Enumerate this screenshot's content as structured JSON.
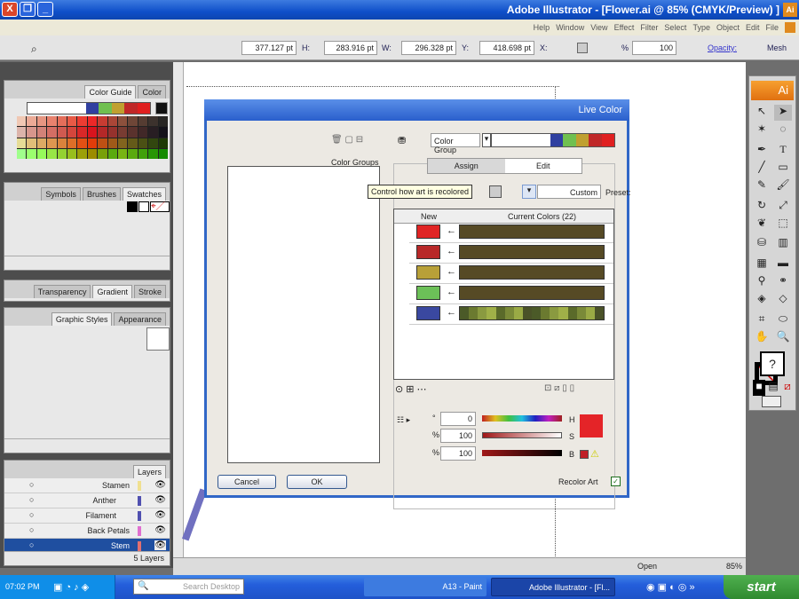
{
  "window": {
    "title": "Adobe Illustrator - [Flower.ai @ 85% (CMYK/Preview) ]",
    "close": "X",
    "restore": "❐",
    "minimize": "_"
  },
  "menu": [
    "File",
    "Edit",
    "Object",
    "Type",
    "Select",
    "Filter",
    "Effect",
    "View",
    "Window",
    "Help"
  ],
  "control": {
    "mode": "Mesh",
    "opacity_label": "Opacity:",
    "opacity": "100",
    "percent": "%",
    "x_label": "X:",
    "x": "418.698 pt",
    "y_label": "Y:",
    "y": "296.328 pt",
    "w_label": "W:",
    "w": "283.916 pt",
    "h_label": "H:",
    "h": "377.127 pt"
  },
  "panels": {
    "color": {
      "tabs": [
        "Color",
        "Color Guide"
      ]
    },
    "swatches": {
      "tabs": [
        "Swatches",
        "Brushes",
        "Symbols"
      ]
    },
    "stroke": {
      "tabs": [
        "Stroke",
        "Gradient",
        "Transparency"
      ]
    },
    "appearance": {
      "tabs": [
        "Appearance",
        "Graphic Styles"
      ]
    },
    "layers": {
      "tab": "Layers",
      "items": [
        "Stamen",
        "Anther",
        "Filament",
        "Back Petals",
        "Stem"
      ],
      "count": "5 Layers",
      "colors": [
        "#f0e090",
        "#5050b0",
        "#5050b0",
        "#e070d0",
        "#e07070"
      ]
    }
  },
  "guide_colors": [
    "#e02020",
    "#c02828",
    "#c0a030",
    "#70c050",
    "#3040a0"
  ],
  "dialog": {
    "title": "Live Color",
    "group_name": "Color Group",
    "color_groups_label": "Color Groups",
    "tabs": [
      "Edit",
      "Assign"
    ],
    "preset_label": "Preset:",
    "preset": "Custom",
    "tooltip": "Control how art is recolored",
    "col_current": "Current Colors (22)",
    "col_new": "New",
    "rows": [
      {
        "new": "#e02424"
      },
      {
        "new": "#b82828"
      },
      {
        "new": "#b8a038"
      },
      {
        "new": "#6cc058"
      },
      {
        "new": "#3a48a0"
      }
    ],
    "h_label": "H",
    "h": "0",
    "h_unit": "°",
    "s_label": "S",
    "s": "100",
    "s_unit": "%",
    "b_label": "B",
    "b": "100",
    "b_unit": "%",
    "swatch": "#e42428",
    "recolor_label": "Recolor Art",
    "ok": "OK",
    "cancel": "Cancel"
  },
  "status": {
    "zoom": "85%",
    "state": "Open"
  },
  "taskbar": {
    "start": "start",
    "tasks": [
      "Adobe Illustrator - [Fl...",
      "A13 - Paint"
    ],
    "search": "Search Desktop",
    "clock": "07:02 PM"
  }
}
